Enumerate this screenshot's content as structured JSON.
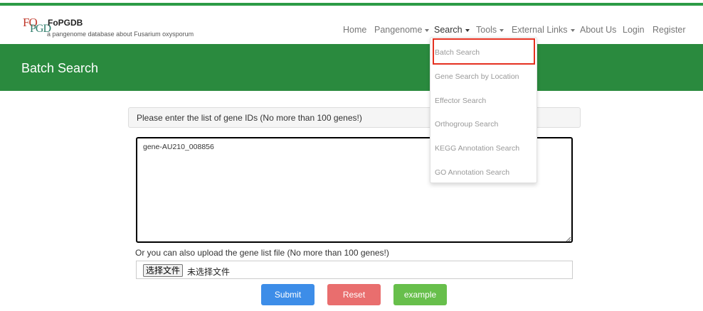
{
  "brand": {
    "logo_top": "FO",
    "logo_bottom": "PGD",
    "name": "FoPGDB",
    "subtitle": "a pangenome database about Fusarium oxysporum"
  },
  "nav": {
    "home": "Home",
    "pangenome": "Pangenome",
    "search": "Search",
    "tools": "Tools",
    "external_links": "External Links",
    "about": "About Us",
    "login": "Login",
    "register": "Register"
  },
  "search_menu": [
    "Batch Search",
    "Gene Search by Location",
    "Effector Search",
    "Orthogroup Search",
    "KEGG Annotation Search",
    "GO Annotation Search"
  ],
  "page_title": "Batch Search",
  "form": {
    "instruction": "Please enter the list of gene IDs (No more than 100 genes!)",
    "gene_ids_value": "gene-AU210_008856",
    "upload_label": "Or you can also upload the gene list file (No more than 100 genes!)",
    "choose_file_label": "选择文件",
    "no_file_text": "未选择文件"
  },
  "buttons": {
    "submit": "Submit",
    "reset": "Reset",
    "example": "example"
  },
  "colors": {
    "top_stripe": "#2c9b46",
    "banner": "#2a8a3e",
    "submit": "#3d8de8",
    "reset": "#e96e6e",
    "example": "#67bf4b",
    "highlight": "#e53020"
  }
}
